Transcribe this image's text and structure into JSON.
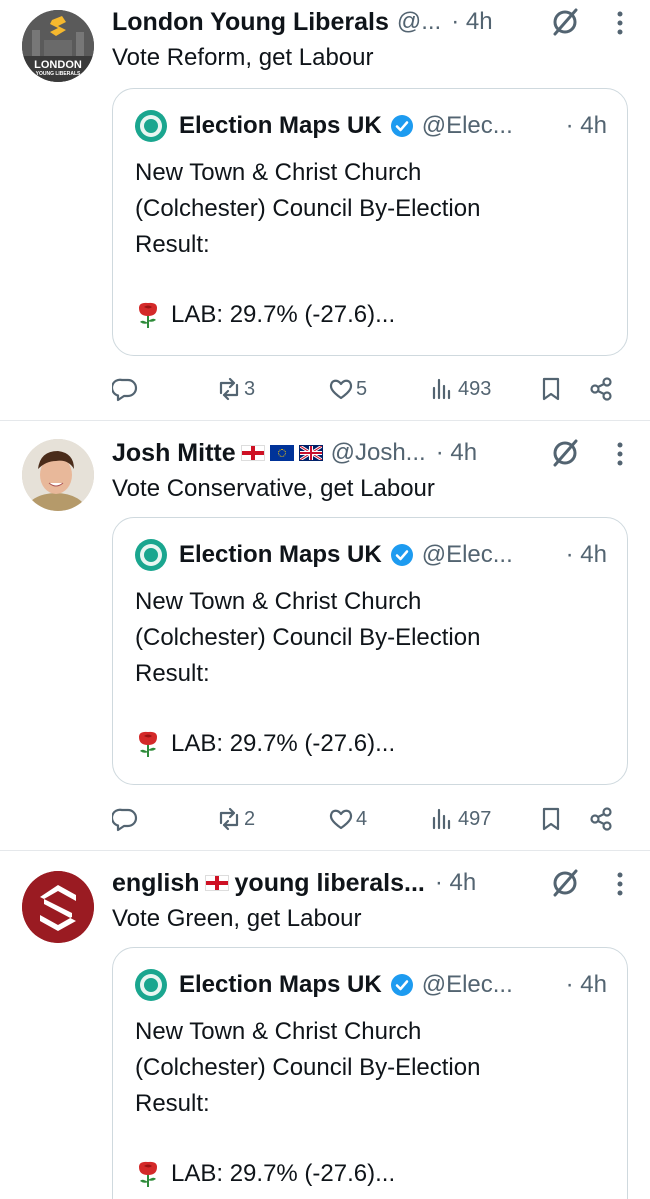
{
  "colors": {
    "text": "#0f1419",
    "secondary": "#536471",
    "border": "#cfd9de",
    "verified": "#1d9bf0"
  },
  "posts": [
    {
      "name": "London Young Liberals",
      "handle": "@...",
      "time": "· 4h",
      "text": "Vote Reform, get Labour",
      "avatar_text": "LONDON",
      "avatar_subtext": "YOUNG LIBERALS",
      "actions": {
        "replies": "",
        "reposts": "3",
        "likes": "5",
        "views": "493"
      }
    },
    {
      "name": "Josh Mitte",
      "handle": "@Josh...",
      "time": "· 4h",
      "text": "Vote Conservative, get Labour",
      "flags": [
        "england-flag",
        "eu-flag",
        "uk-flag"
      ],
      "actions": {
        "replies": "",
        "reposts": "2",
        "likes": "4",
        "views": "497"
      }
    },
    {
      "name_part1": "english",
      "name_part2": "young liberals...",
      "time": "· 4h",
      "text": "Vote Green, get Labour"
    }
  ],
  "quote": {
    "name": "Election Maps UK",
    "handle": "@Elec...",
    "time": "· 4h",
    "line1": "New Town & Christ Church",
    "line2": "(Colchester) Council By-Election",
    "line3": "Result:",
    "result": "LAB: 29.7% (-27.6)..."
  }
}
